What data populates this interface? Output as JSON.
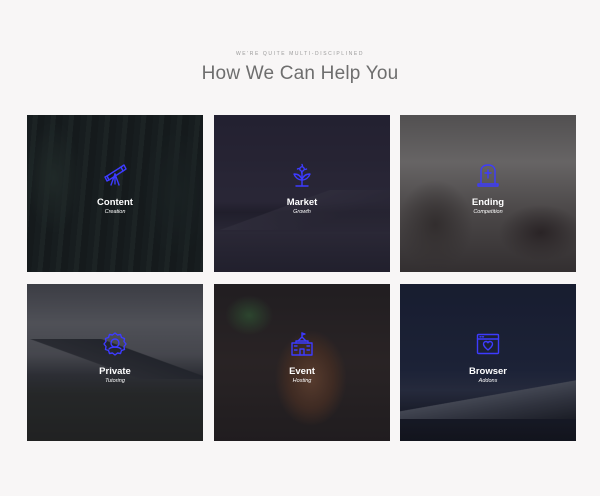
{
  "section": {
    "eyebrow": "WE'RE QUITE MULTI-DISCIPLINED",
    "title": "How We Can Help You"
  },
  "services": [
    {
      "title": "Content",
      "subtitle": "Creation",
      "icon": "telescope-icon"
    },
    {
      "title": "Market",
      "subtitle": "Growth",
      "icon": "flower-plant-icon"
    },
    {
      "title": "Ending",
      "subtitle": "Competition",
      "icon": "tombstone-icon"
    },
    {
      "title": "Private",
      "subtitle": "Tutoring",
      "icon": "badge-face-icon"
    },
    {
      "title": "Event",
      "subtitle": "Hosting",
      "icon": "building-icon"
    },
    {
      "title": "Browser",
      "subtitle": "Addons",
      "icon": "browser-heart-icon"
    }
  ],
  "colors": {
    "background": "#f8f6f6",
    "icon_accent": "#3d3bff",
    "label_text": "#ffffff",
    "title_text": "#6e6e6e"
  }
}
